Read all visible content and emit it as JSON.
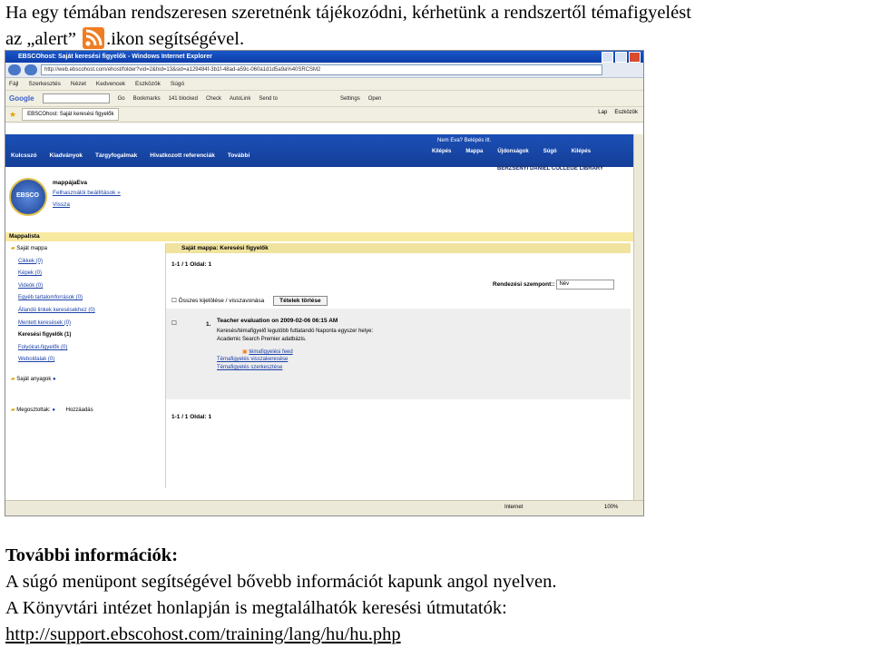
{
  "intro": {
    "line1": "Ha egy témában rendszeresen szeretnénk tájékozódni, kérhetünk a rendszertől témafigyelést",
    "line2_before": "az „alert”",
    "line2_after": ".ikon segítségével.",
    "icon": "rss-icon",
    "icon_color": "#f07d22"
  },
  "browser": {
    "title": "EBSCOhost: Saját keresési figyelők - Windows Internet Explorer",
    "address": "http://web.ebscohost.com/ehost/folder?vid=2&hid=13&sid=a129484f-3b1f-48ad-a59c-060a1d1d5a9a%40SRCSM2",
    "menu": [
      "Fájl",
      "Szerkesztés",
      "Nézet",
      "Kedvencek",
      "Eszközök",
      "Súgó"
    ],
    "google_bar": [
      "Google",
      "Go",
      "Bookmarks",
      "141 blocked",
      "Check",
      "AutoLink",
      "Send to",
      "Settings",
      "Open"
    ],
    "tab": "EBSCOhost: Saját keresési figyelők",
    "tab_tools": [
      "Lap",
      "Eszközök"
    ],
    "status": {
      "zone": "Internet",
      "zoom": "100%"
    }
  },
  "ebsco": {
    "nav": [
      "Kulcsszó",
      "Kiadványok",
      "Tárgyfogalmak",
      "Hivatkozott referenciák",
      "További"
    ],
    "user": "Nem Eva? Belépés itt.",
    "tools": [
      "Kilépés",
      "Mappa",
      "Újdonságok",
      "Súgó",
      "Kilépés"
    ],
    "library": "BERZSENYI DANIEL COLLEGE LIBRARY",
    "logo": "EBSCO",
    "folder_title": "mappájaEva",
    "folder_link": "Felhasználói beállítások »",
    "back_link": "Vissza",
    "list_header": "Mappalista",
    "tree_root": "Saját mappa",
    "tree": [
      {
        "label": "Cikkek (0)",
        "bold": false
      },
      {
        "label": "Képek (0)",
        "bold": false
      },
      {
        "label": "Videók (0)",
        "bold": false
      },
      {
        "label": "Egyéb tartalomforrások (0)",
        "bold": false
      },
      {
        "label": "Állandó linkek keresésekhez (0)",
        "bold": false
      },
      {
        "label": "Mentett keresések (0)",
        "bold": false
      },
      {
        "label": "Keresési figyelők (1)",
        "bold": true
      },
      {
        "label": "Folyóirat-figyelők (0)",
        "bold": false
      },
      {
        "label": "Weboldalak (0)",
        "bold": false
      }
    ],
    "own_items": "Saját anyagok",
    "shared": "Megosztottak:",
    "add_link": "Hozzáadás",
    "main_title": "Saját mappa: Keresési figyelők",
    "pager": "1-1 / 1   Oldal: 1",
    "sort_label": "Rendezési szempont::",
    "sort_value": "Név",
    "select_all": "Összes kijelölése / visszavonása",
    "delete_button": "Tételek törlése",
    "result_num": "1.",
    "result_title": "Teacher evaluation on 2009-02-06 06:15 AM",
    "result_desc1": "Keresés/témafigyelő legutóbb futtatandó Naponta egyszer helye:",
    "result_desc2": "Academic Search Premier adatbázis.",
    "result_links": [
      "témafigyelési feed",
      "Témafigyelés visszakeresése",
      "Témafigyelés szerkesztése"
    ],
    "pager_bottom": "1-1 / 1   Oldal: 1"
  },
  "more_info": {
    "heading": "További információk:",
    "line1": "A súgó menüpont segítségével bővebb információt kapunk angol nyelven.",
    "line2": "A Könyvtári intézet honlapján is megtalálhatók keresési útmutatók:",
    "url": "http://support.ebscohost.com/training/lang/hu/hu.php"
  }
}
